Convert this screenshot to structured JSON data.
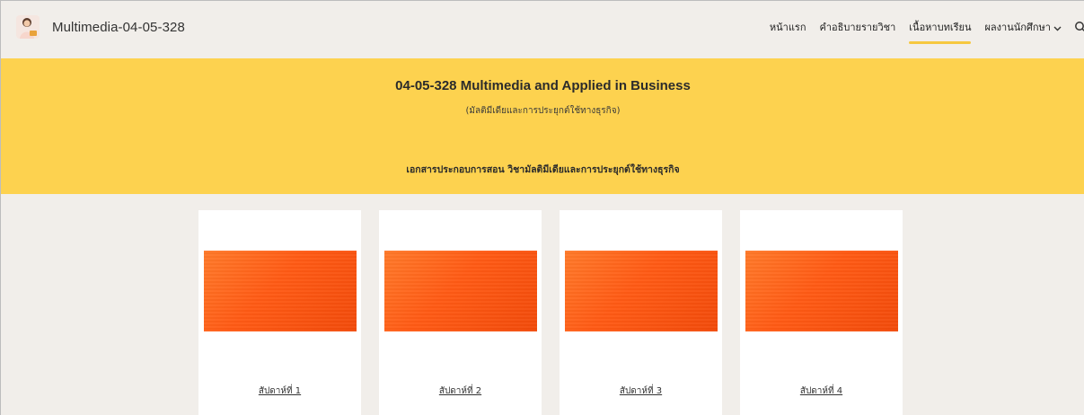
{
  "site": {
    "title": "Multimedia-04-05-328",
    "logo_icon": "profile-avatar-icon"
  },
  "nav": {
    "items": [
      {
        "label": "หน้าแรก",
        "active": false
      },
      {
        "label": "คำอธิบายรายวิชา",
        "active": false
      },
      {
        "label": "เนื้อหาบทเรียน",
        "active": true
      },
      {
        "label": "ผลงานนักศึกษา",
        "active": false,
        "has_dropdown": true
      }
    ],
    "dropdown_icon": "chevron-down-icon",
    "search_icon": "search-icon"
  },
  "banner": {
    "title": "04-05-328 Multimedia and Applied in Business",
    "subtitle": "(มัลติมีเดียและการประยุกต์ใช้ทางธุรกิจ)",
    "description": "เอกสารประกอบการสอน วิชามัลติมีเดียและการประยุกต์ใช้ทางธุรกิจ",
    "background": "#fdd24f"
  },
  "cards": [
    {
      "label": "สัปดาห์ที่ 1"
    },
    {
      "label": "สัปดาห์ที่ 2"
    },
    {
      "label": "สัปดาห์ที่ 3"
    },
    {
      "label": "สัปดาห์ที่ 4"
    }
  ],
  "colors": {
    "page_bg": "#f1eeea",
    "accent": "#f6c840",
    "thumbnail": "#ff5a14"
  }
}
